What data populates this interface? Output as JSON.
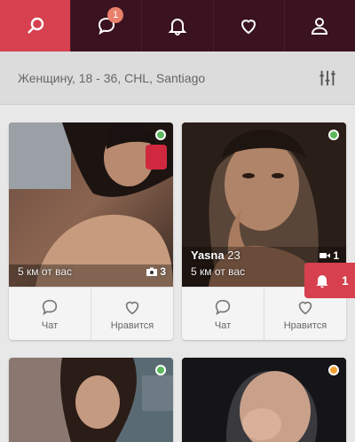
{
  "nav": {
    "items": [
      {
        "name": "search",
        "icon": "search-icon",
        "active": true
      },
      {
        "name": "messages",
        "icon": "chat-bubble-icon",
        "badge": "1"
      },
      {
        "name": "notifications",
        "icon": "bell-icon"
      },
      {
        "name": "favorites",
        "icon": "heart-icon"
      },
      {
        "name": "profile",
        "icon": "user-icon"
      }
    ]
  },
  "filter": {
    "text": "Женщину, 18 - 36, CHL, Santiago",
    "icon": "sliders-icon"
  },
  "cards": [
    {
      "name": "",
      "age": "",
      "distance": "5 км от вас",
      "media_count": "3",
      "media_type": "camera-icon",
      "online_color": "#5cb85c",
      "chat_label": "Чат",
      "like_label": "Нравится"
    },
    {
      "name": "Yasna",
      "age": "23",
      "distance": "5 км от вас",
      "media_count": "1",
      "media_type": "video-icon",
      "online_color": "#5cb85c",
      "chat_label": "Чат",
      "like_label": "Нравится"
    },
    {
      "online_color": "#5cb85c"
    },
    {
      "online_color": "#f0a030"
    }
  ],
  "floating_notification": {
    "icon": "bell-icon",
    "count": "1"
  },
  "colors": {
    "accent": "#d6404f",
    "nav_bg": "#3a1220",
    "online": "#5cb85c",
    "away": "#f0a030"
  }
}
